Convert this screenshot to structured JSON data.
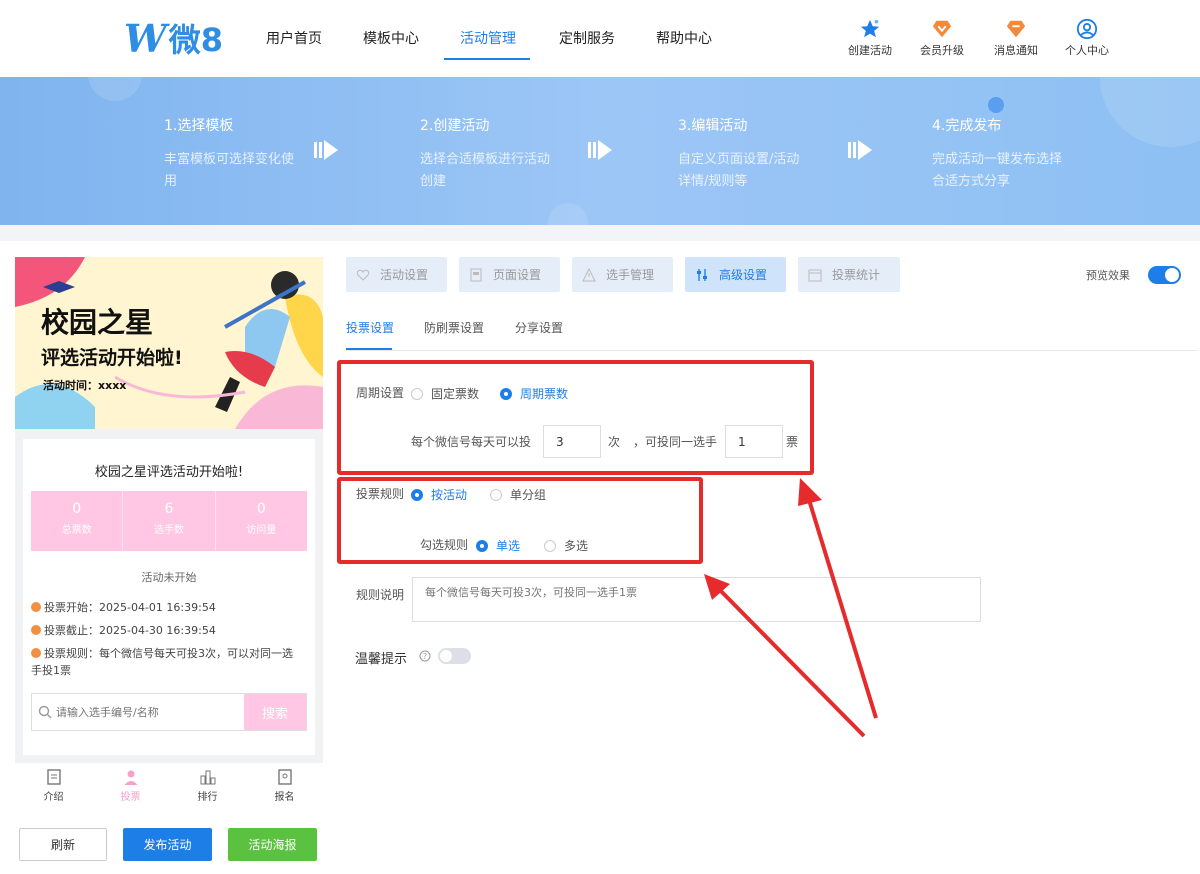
{
  "brand": {
    "logo_letter": "W",
    "logo_text": "微8"
  },
  "nav": {
    "items": [
      "用户首页",
      "模板中心",
      "活动管理",
      "定制服务",
      "帮助中心"
    ],
    "active": "活动管理"
  },
  "top_actions": {
    "create": "创建活动",
    "upgrade": "会员升级",
    "notify": "消息通知",
    "profile": "个人中心"
  },
  "steps": [
    {
      "title": "1.选择模板",
      "desc": "丰富模板可选择变化使用"
    },
    {
      "title": "2.创建活动",
      "desc": "选择合适模板进行活动创建"
    },
    {
      "title": "3.编辑活动",
      "desc": "自定义页面设置/活动详情/规则等"
    },
    {
      "title": "4.完成发布",
      "desc": "完成活动一键发布选择合适方式分享"
    }
  ],
  "preview": {
    "poster_title": "校园之星",
    "poster_sub": "评选活动开始啦!",
    "poster_time": "活动时间：xxxx",
    "card_title": "校园之星评选活动开始啦!",
    "stats": [
      {
        "num": "0",
        "label": "总票数"
      },
      {
        "num": "6",
        "label": "选手数"
      },
      {
        "num": "0",
        "label": "访问量"
      }
    ],
    "status": "活动未开始",
    "vote_start": "投票开始：2025-04-01 16:39:54",
    "vote_end": "投票截止：2025-04-30 16:39:54",
    "vote_rule": "投票规则：每个微信号每天可投3次，可以对同一选手投1票",
    "search_placeholder": "请输入选手编号/名称",
    "search_button": "搜索",
    "tabbar": [
      "介绍",
      "投票",
      "排行",
      "报名"
    ]
  },
  "buttons": {
    "refresh": "刷新",
    "publish": "发布活动",
    "poster": "活动海报"
  },
  "tool_tabs": [
    "活动设置",
    "页面设置",
    "选手管理",
    "高级设置",
    "投票统计"
  ],
  "preview_toggle": {
    "label": "预览效果",
    "on": true
  },
  "sub_tabs": [
    "投票设置",
    "防刷票设置",
    "分享设置"
  ],
  "form": {
    "period_label": "周期设置",
    "period_options": [
      "固定票数",
      "周期票数"
    ],
    "per_day_label": "每个微信号每天可以投",
    "per_day_value": "3",
    "times_unit": "次",
    "same_label": "，可投同一选手",
    "same_value": "1",
    "vote_unit": "票",
    "rule_label": "投票规则",
    "rule_options": [
      "按活动",
      "单分组"
    ],
    "select_label": "勾选规则",
    "select_options": [
      "单选",
      "多选"
    ],
    "desc_label": "规则说明",
    "desc_placeholder": "每个微信号每天可投3次，可投同一选手1票",
    "tip_label": "温馨提示",
    "tip_on": false
  },
  "colors": {
    "primary": "#1e7ee8",
    "annotation": "#e52b2b",
    "pink": "#ffc7e3",
    "green": "#5bc241"
  }
}
